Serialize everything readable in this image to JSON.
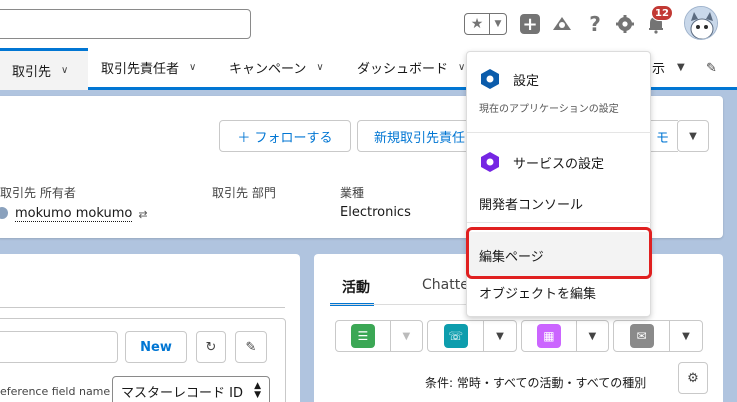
{
  "header": {
    "notification_count": "12"
  },
  "nav": {
    "items": [
      {
        "label": "取引先"
      },
      {
        "label": "取引先責任者"
      },
      {
        "label": "キャンペーン"
      },
      {
        "label": "ダッシュボード"
      },
      {
        "label": "示"
      }
    ]
  },
  "record": {
    "follow_label": "＋ フォローする",
    "new_contact_label": "新規取引先責任",
    "memo_label": "モ",
    "owner_label": "取引先 所有者",
    "owner_value": "mokumo mokumo",
    "dept_label": "取引先 部門",
    "industry_label": "業種",
    "industry_value": "Electronics"
  },
  "left_panel": {
    "new_label": "New",
    "ref_field_label": "eference field name",
    "select_value": "マスターレコード ID"
  },
  "right_panel": {
    "tab_activity": "活動",
    "tab_chatter": "Chatte",
    "filter_text": "条件: 常時・すべての活動・すべての種別"
  },
  "menu": {
    "settings_label": "設定",
    "settings_sub": "現在のアプリケーションの設定",
    "service_label": "サービスの設定",
    "devconsole_label": "開発者コンソール",
    "edit_page_label": "編集ページ",
    "edit_object_label": "オブジェクトを編集"
  },
  "colors": {
    "accent": "#0176d3",
    "settings_icon": "#0b5cab",
    "service_icon": "#7526e3",
    "highlight": "#e02020"
  }
}
